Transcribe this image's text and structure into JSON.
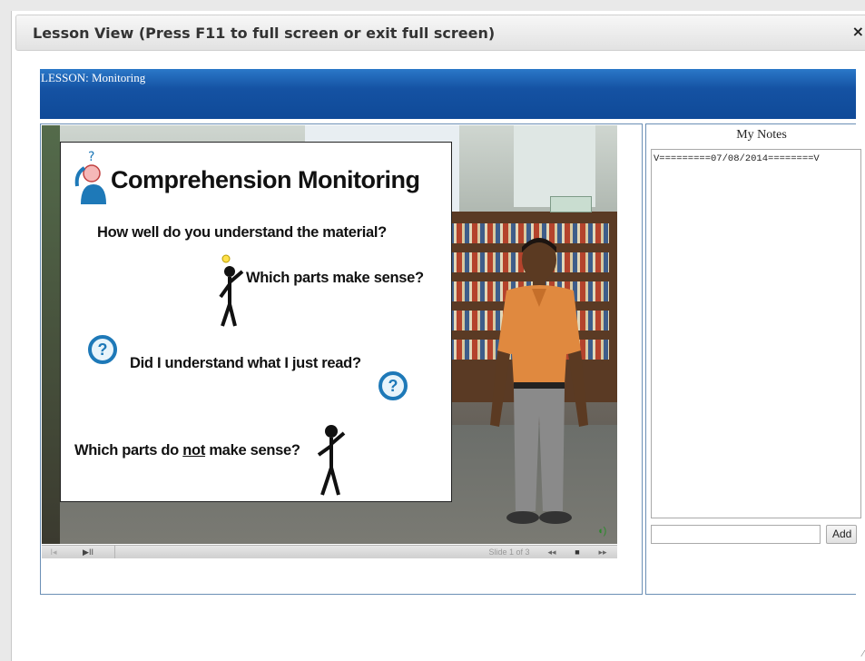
{
  "window": {
    "title": "Lesson View (Press F11 to full screen or exit full screen)",
    "close_symbol": "×"
  },
  "lesson": {
    "header_label": "LESSON: Monitoring"
  },
  "slide": {
    "title": "Comprehension Monitoring",
    "line1": "How well do you understand the material?",
    "line2": "Which parts make sense?",
    "line3": "Did I understand what I just read?",
    "line4_prefix": "Which parts do ",
    "line4_underlined": "not",
    "line4_suffix": " make sense?"
  },
  "player": {
    "prev_symbol": "I◂",
    "play_symbol": "▶II",
    "slide_counter": "Slide 1 of 3",
    "rewind_symbol": "◂◂",
    "stop_symbol": "■",
    "forward_symbol": "▸▸"
  },
  "notes": {
    "title": "My Notes",
    "content": "V=========07/08/2014========V",
    "input_value": "",
    "add_label": "Add"
  }
}
